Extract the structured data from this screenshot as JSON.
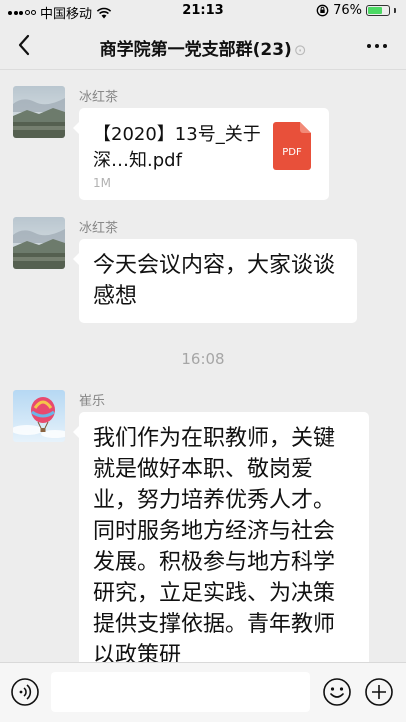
{
  "status_bar": {
    "carrier": "中国移动",
    "time": "21:13",
    "battery_percent": "76%",
    "battery_level": 0.76
  },
  "nav": {
    "title": "商学院第一党支部群(23)",
    "back_icon": "chevron-left-icon",
    "more_icon": "more-dots-icon",
    "mute_icon": "ear-icon"
  },
  "messages": [
    {
      "sender": "冰红茶",
      "type": "file",
      "file_name": "【2020】13号_关于深…知.pdf",
      "file_size": "1M",
      "file_badge": "PDF"
    },
    {
      "sender": "冰红茶",
      "type": "text",
      "text": "今天会议内容，大家谈谈感想"
    },
    {
      "sender": "崔乐",
      "type": "text",
      "text": "我们作为在职教师，关键就是做好本职、敬岗爱业，努力培养优秀人才。同时服务地方经济与社会发展。积极参与地方科学研究，立足实践、为决策提供支撑依据。青年教师以政策研"
    }
  ],
  "time_divider": "16:08",
  "input_bar": {
    "voice_icon": "voice-icon",
    "emoji_icon": "emoji-icon",
    "add_icon": "plus-circle-icon",
    "input_value": ""
  },
  "colors": {
    "background": "#ededed",
    "bubble": "#ffffff",
    "pdf_red": "#e8503a",
    "battery_green": "#4cd964"
  }
}
